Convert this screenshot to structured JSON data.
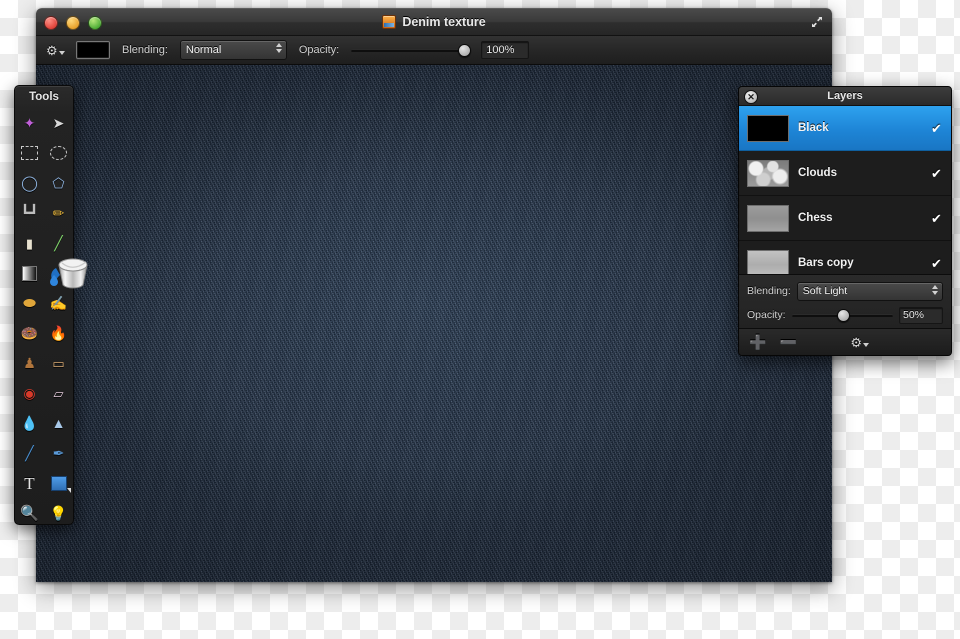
{
  "window": {
    "title": "Denim texture",
    "doc_icon": "document-icon",
    "traffic_lights": [
      "close",
      "minimize",
      "zoom"
    ],
    "expand_icon": "expand-arrows-icon"
  },
  "toolbar": {
    "gear_icon": "gear-dropdown-icon",
    "color_swatch": "#000000",
    "blending_label": "Blending:",
    "blending_value": "Normal",
    "opacity_label": "Opacity:",
    "opacity_value": "100%",
    "opacity_percent": 100
  },
  "tools_panel": {
    "title": "Tools",
    "active_tool": "paint-bucket",
    "items": [
      {
        "name": "magic-wand-tool",
        "glyph": "✦"
      },
      {
        "name": "move-tool",
        "glyph": "➤"
      },
      {
        "name": "rectangular-marquee-tool",
        "glyph": ""
      },
      {
        "name": "elliptical-marquee-tool",
        "glyph": ""
      },
      {
        "name": "lasso-tool",
        "glyph": "◯"
      },
      {
        "name": "polygonal-lasso-tool",
        "glyph": "⬠"
      },
      {
        "name": "crop-tool",
        "glyph": "⌗"
      },
      {
        "name": "pencil-tool",
        "glyph": "✏"
      },
      {
        "name": "eraser-tool",
        "glyph": "▰"
      },
      {
        "name": "paintbrush-tool",
        "glyph": "╱"
      },
      {
        "name": "gradient-tool",
        "glyph": "■"
      },
      {
        "name": "paint-bucket-tool",
        "glyph": ""
      },
      {
        "name": "dodge-tool",
        "glyph": "⬬"
      },
      {
        "name": "smudge-tool",
        "glyph": "✋"
      },
      {
        "name": "sponge-tool",
        "glyph": "⸙"
      },
      {
        "name": "burn-tool",
        "glyph": "◕"
      },
      {
        "name": "clone-stamp-tool",
        "glyph": "♟"
      },
      {
        "name": "patch-tool",
        "glyph": "▭"
      },
      {
        "name": "red-eye-tool",
        "glyph": "◉"
      },
      {
        "name": "block-eraser-tool",
        "glyph": "▱"
      },
      {
        "name": "blur-tool",
        "glyph": "●"
      },
      {
        "name": "sharpen-tool",
        "glyph": "▲"
      },
      {
        "name": "pen-tool",
        "glyph": "╱"
      },
      {
        "name": "ink-pen-tool",
        "glyph": "✒"
      },
      {
        "name": "type-tool",
        "glyph": "T"
      },
      {
        "name": "shape-tool",
        "glyph": ""
      },
      {
        "name": "zoom-tool",
        "glyph": "⚲"
      },
      {
        "name": "eyedropper-tool",
        "glyph": "✐"
      }
    ]
  },
  "layers_panel": {
    "title": "Layers",
    "close_icon": "close-icon",
    "layers": [
      {
        "name": "Black",
        "thumb": "black",
        "visible": true,
        "checkmark": "✔",
        "selected": true
      },
      {
        "name": "Clouds",
        "thumb": "clouds",
        "visible": true,
        "checkmark": "✔",
        "selected": false
      },
      {
        "name": "Chess",
        "thumb": "chess",
        "visible": true,
        "checkmark": "✔",
        "selected": false
      },
      {
        "name": "Bars copy",
        "thumb": "bars",
        "visible": true,
        "checkmark": "✔",
        "selected": false
      }
    ],
    "blending_label": "Blending:",
    "blending_value": "Soft Light",
    "opacity_label": "Opacity:",
    "opacity_value": "50%",
    "opacity_percent": 50,
    "footer": {
      "add_label": "➕",
      "remove_label": "➖",
      "gear_icon": "gear-dropdown-icon"
    }
  },
  "canvas": {
    "description": "denim-texture-canvas",
    "base_color": "#1e2e44"
  },
  "accent_color": "#1e85d6"
}
